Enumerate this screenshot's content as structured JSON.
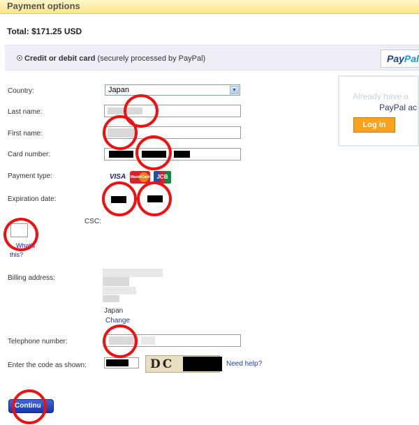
{
  "header": {
    "title": "Payment options"
  },
  "total": {
    "label": "Total:",
    "amount": "$171.25 USD"
  },
  "payment_method": {
    "option_bold": "Credit or debit card",
    "option_note": " (securely processed by PayPal)",
    "logo_pay": "Pay",
    "logo_pal": "Pal"
  },
  "login_panel": {
    "faded_text": "Already have a",
    "strong_text": "PayPal ac",
    "button_label": "Log in"
  },
  "form": {
    "country_label": "Country:",
    "country_value": "Japan",
    "last_name_label": "Last name:",
    "first_name_label": "First name:",
    "card_number_label": "Card number:",
    "payment_type_label": "Payment type:",
    "expiration_label": "Expiration date:",
    "csc_label": "CSC:",
    "whats_this_1": "What's",
    "whats_this_2": "this?",
    "billing_address_label": "Billing address:",
    "billing_country": "Japan",
    "change_link": "Change",
    "telephone_label": "Telephone number:",
    "code_label": "Enter the code as shown:",
    "captcha_visible": "DC",
    "need_help": "Need help?",
    "continue_label": "Continu"
  },
  "card_types": {
    "visa": "VISA",
    "mastercard": "MasterCard",
    "jcb": "JCB"
  },
  "colors": {
    "annotation": "#f01010",
    "accent_blue": "#1636a8",
    "header_yellow": "#ffe58a",
    "login_orange": "#f7a31b"
  }
}
